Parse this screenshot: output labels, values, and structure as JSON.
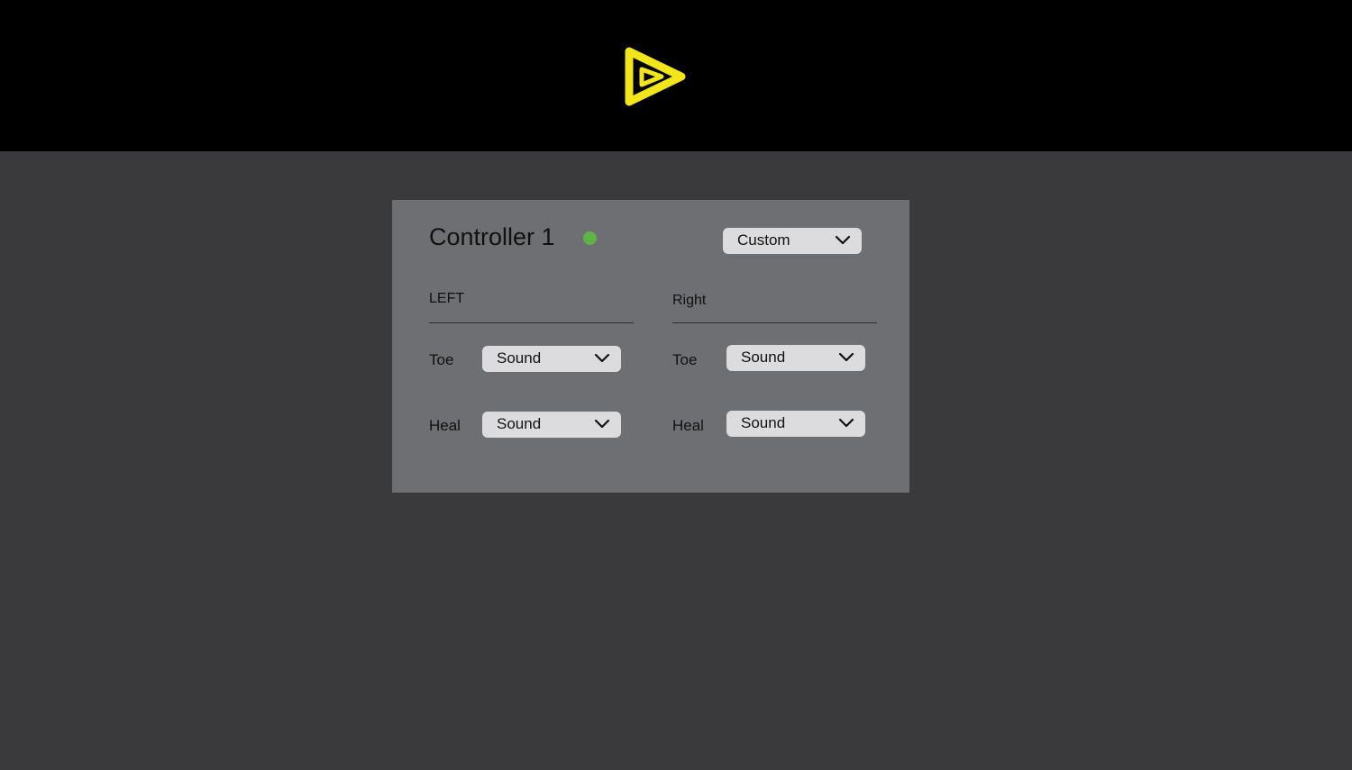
{
  "header": {
    "logo_icon": "play-triangle-icon",
    "logo_color": "#f2e61b"
  },
  "controller": {
    "title": "Controller 1",
    "status_color": "#5fb447",
    "preset": {
      "selected": "Custom"
    },
    "left": {
      "label": "LEFT",
      "toe_label": "Toe",
      "toe_value": "Sound",
      "heal_label": "Heal",
      "heal_value": "Sound"
    },
    "right": {
      "label": "Right",
      "toe_label": "Toe",
      "toe_value": "Sound",
      "heal_label": "Heal",
      "heal_value": "Sound"
    }
  },
  "colors": {
    "background": "#3a3a3c",
    "header": "#000000",
    "panel": "#6e6f72",
    "dropdown": "#dcdcde"
  }
}
